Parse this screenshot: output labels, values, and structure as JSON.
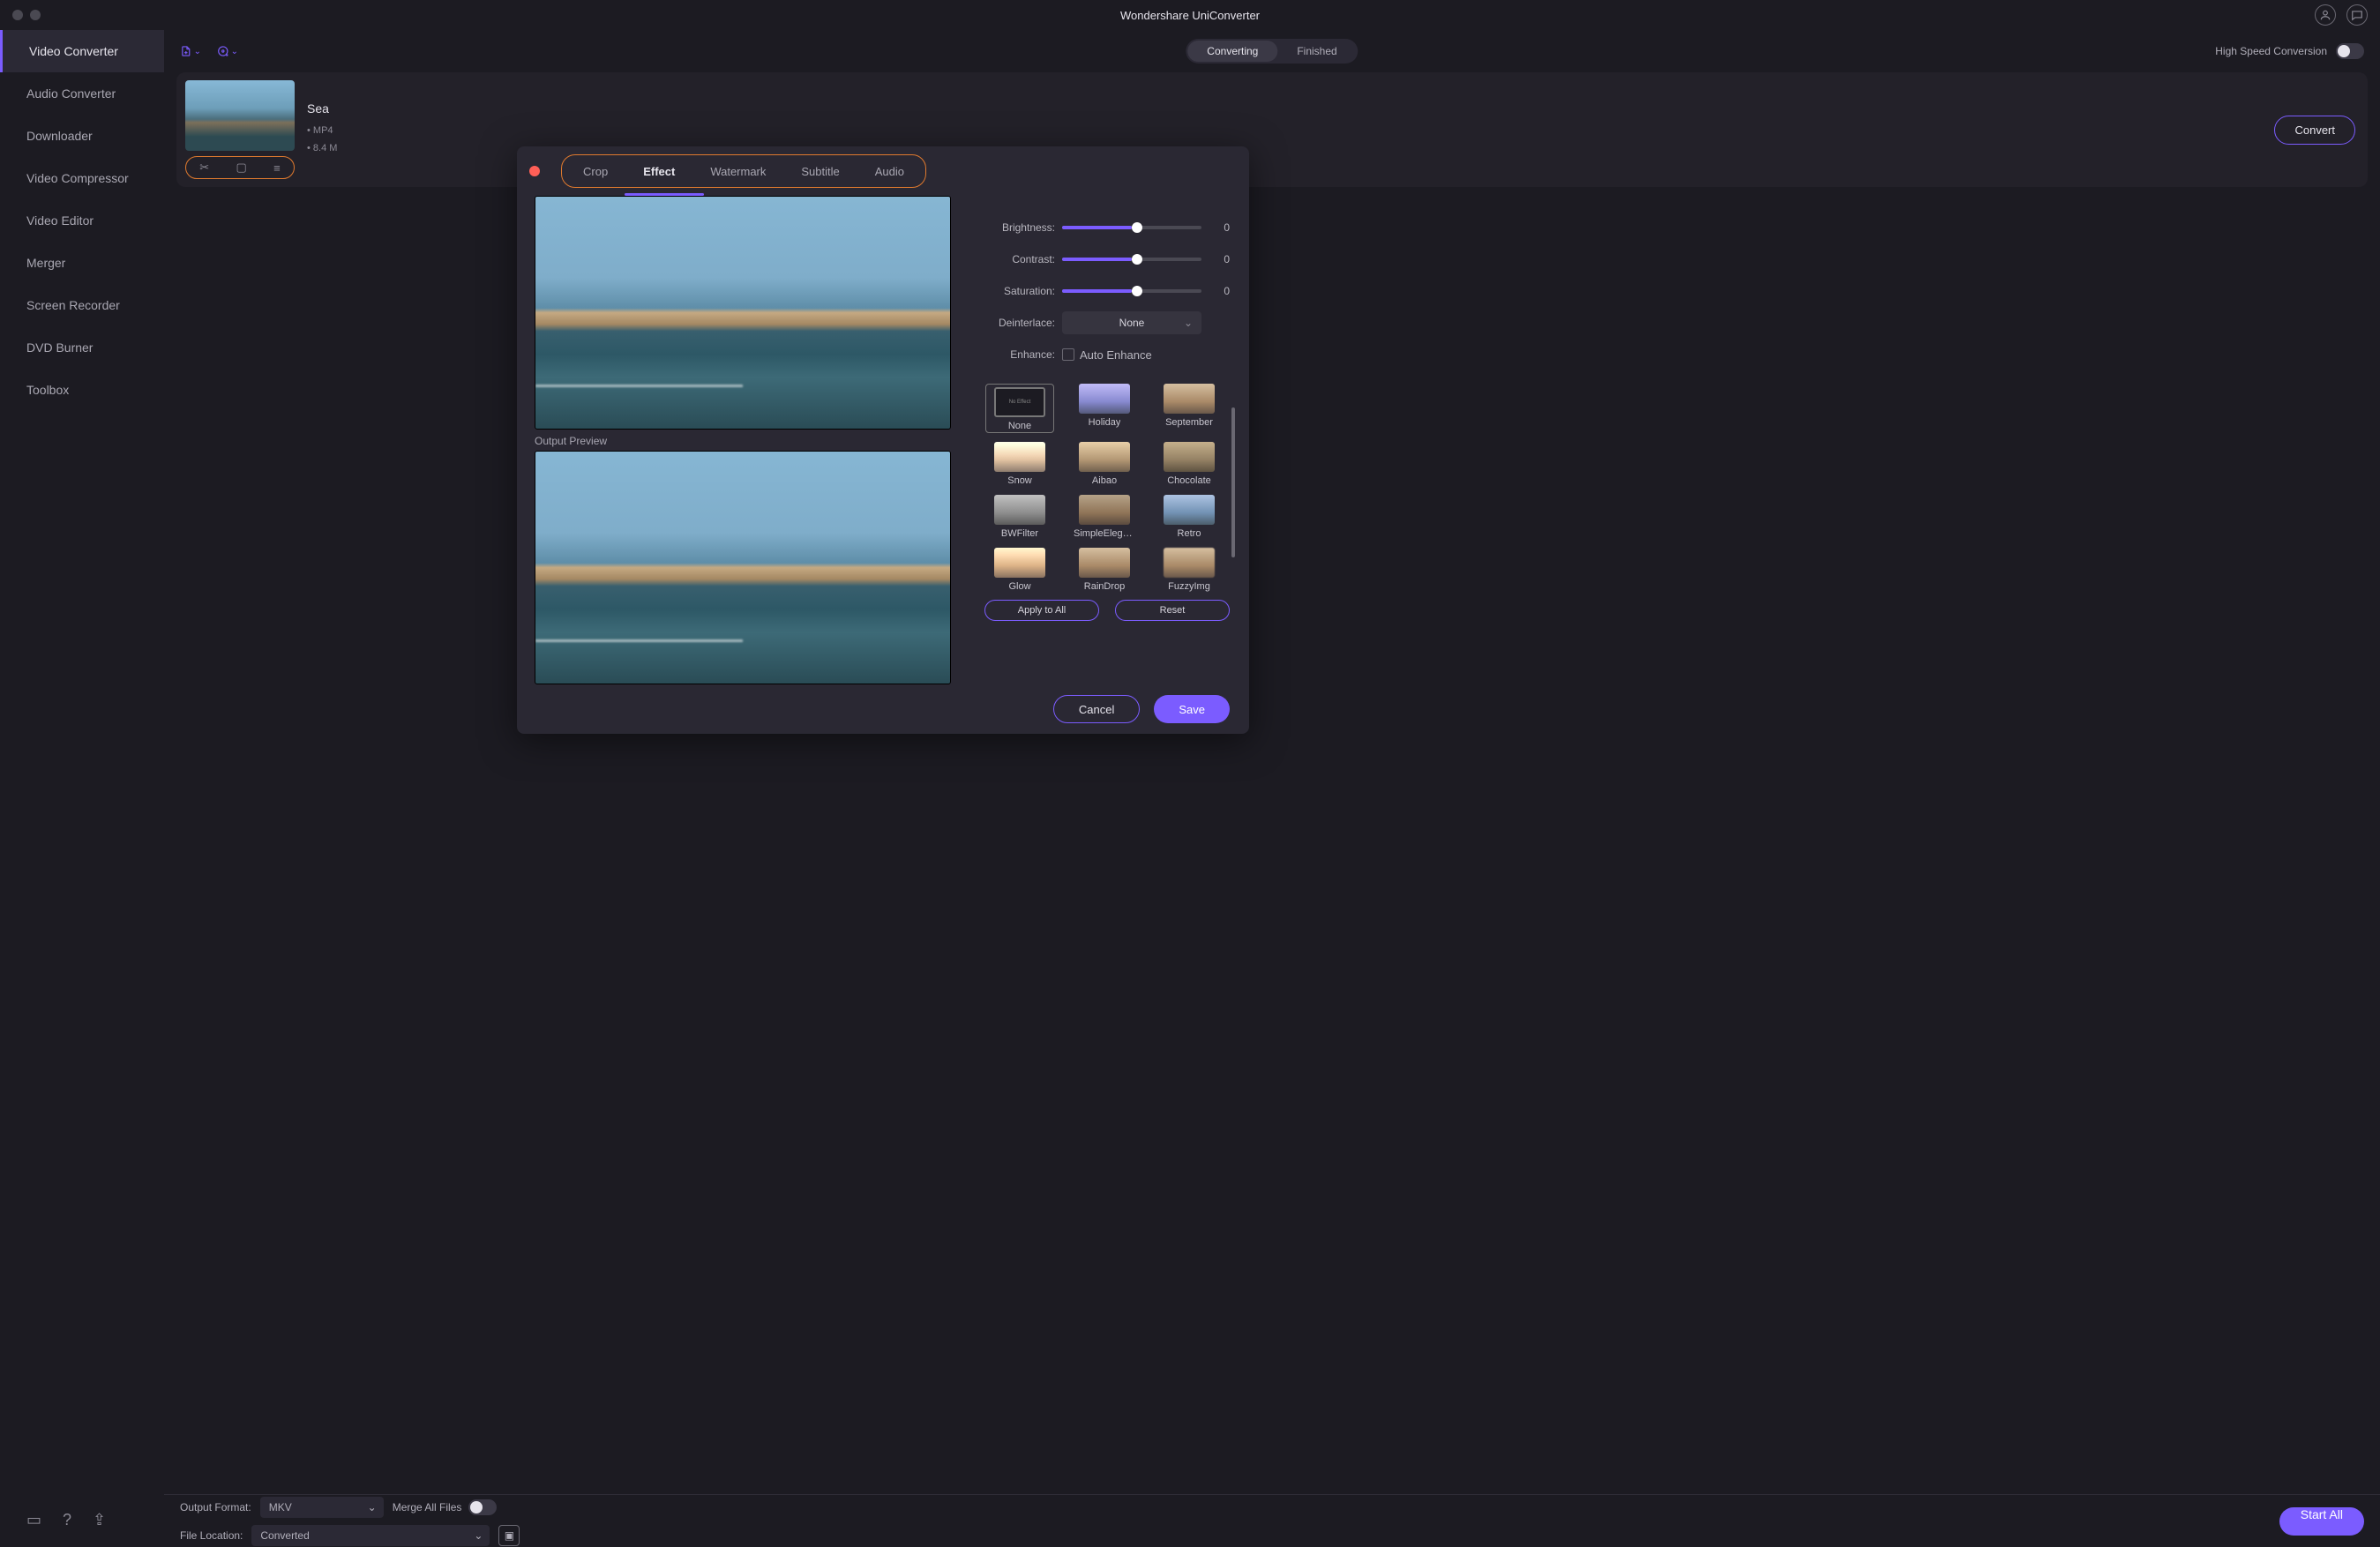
{
  "window": {
    "title": "Wondershare UniConverter"
  },
  "sidebar": {
    "items": [
      "Video Converter",
      "Audio Converter",
      "Downloader",
      "Video Compressor",
      "Video Editor",
      "Merger",
      "Screen Recorder",
      "DVD Burner",
      "Toolbox"
    ]
  },
  "toolbar": {
    "segments": {
      "converting": "Converting",
      "finished": "Finished"
    },
    "high_speed": "High Speed Conversion"
  },
  "item": {
    "title": "Sea",
    "format": "MP4",
    "size": "8.4 M",
    "convert": "Convert"
  },
  "dlg": {
    "tabs": {
      "crop": "Crop",
      "effect": "Effect",
      "watermark": "Watermark",
      "subtitle": "Subtitle",
      "audio": "Audio"
    },
    "output_preview": "Output Preview",
    "controls": {
      "brightness": {
        "label": "Brightness:",
        "value": "0"
      },
      "contrast": {
        "label": "Contrast:",
        "value": "0"
      },
      "saturation": {
        "label": "Saturation:",
        "value": "0"
      },
      "deinterlace": {
        "label": "Deinterlace:",
        "value": "None"
      },
      "enhance": {
        "label": "Enhance:",
        "auto": "Auto Enhance"
      }
    },
    "filters": [
      "None",
      "Holiday",
      "September",
      "Snow",
      "Aibao",
      "Chocolate",
      "BWFilter",
      "SimpleElegant",
      "Retro",
      "Glow",
      "RainDrop",
      "FuzzyImg"
    ],
    "apply_all": "Apply to All",
    "reset": "Reset",
    "cancel": "Cancel",
    "save": "Save"
  },
  "bottom": {
    "output_format_label": "Output Format:",
    "output_format_value": "MKV",
    "file_location_label": "File Location:",
    "file_location_value": "Converted",
    "merge_all": "Merge All Files",
    "start_all": "Start All"
  }
}
